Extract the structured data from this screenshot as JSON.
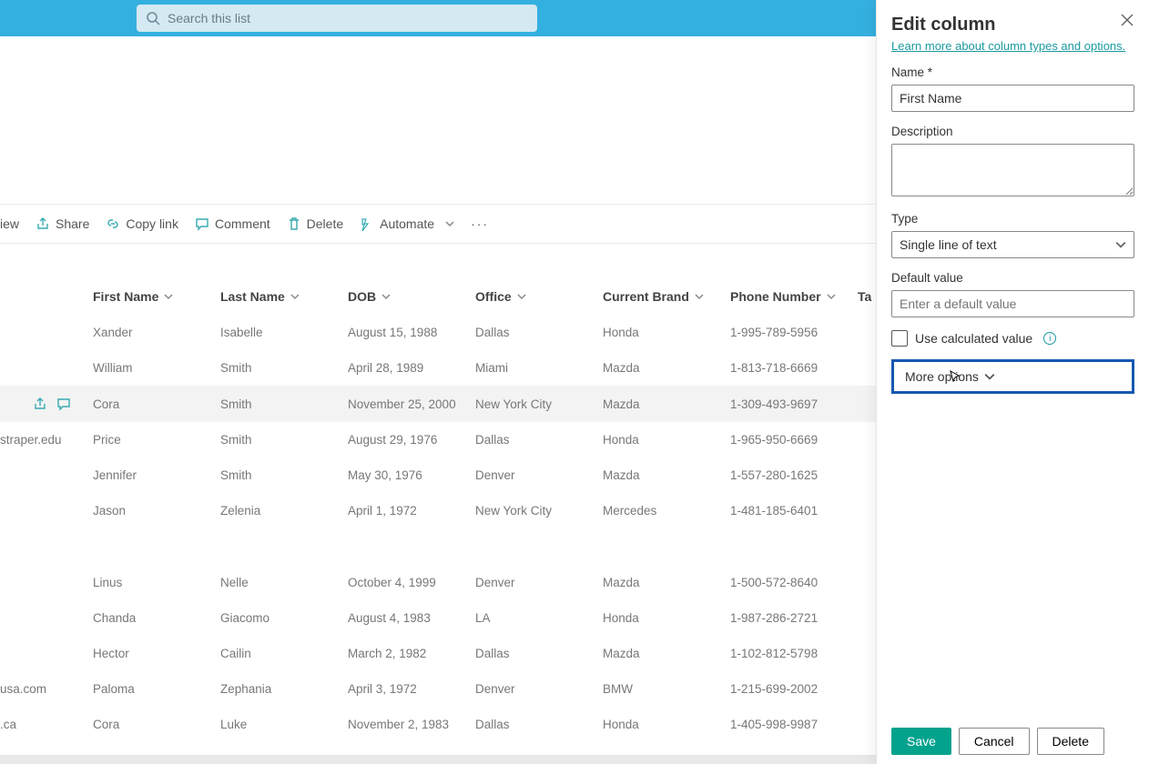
{
  "search": {
    "placeholder": "Search this list"
  },
  "commands": {
    "view": "iew",
    "share": "Share",
    "copylink": "Copy link",
    "comment": "Comment",
    "delete": "Delete",
    "automate": "Automate"
  },
  "columns": {
    "first_name": "First Name",
    "last_name": "Last Name",
    "dob": "DOB",
    "office": "Office",
    "current_brand": "Current Brand",
    "phone_number": "Phone Number",
    "ta": "Ta"
  },
  "rows": [
    {
      "pre": "",
      "first": "Xander",
      "last": "Isabelle",
      "dob": "August 15, 1988",
      "office": "Dallas",
      "brand": "Honda",
      "phone": "1-995-789-5956"
    },
    {
      "pre": "",
      "first": "William",
      "last": "Smith",
      "dob": "April 28, 1989",
      "office": "Miami",
      "brand": "Mazda",
      "phone": "1-813-718-6669"
    },
    {
      "pre": "",
      "first": "Cora",
      "last": "Smith",
      "dob": "November 25, 2000",
      "office": "New York City",
      "brand": "Mazda",
      "phone": "1-309-493-9697",
      "selected": true
    },
    {
      "pre": "straper.edu",
      "first": "Price",
      "last": "Smith",
      "dob": "August 29, 1976",
      "office": "Dallas",
      "brand": "Honda",
      "phone": "1-965-950-6669"
    },
    {
      "pre": "",
      "first": "Jennifer",
      "last": "Smith",
      "dob": "May 30, 1976",
      "office": "Denver",
      "brand": "Mazda",
      "phone": "1-557-280-1625"
    },
    {
      "pre": "",
      "first": "Jason",
      "last": "Zelenia",
      "dob": "April 1, 1972",
      "office": "New York City",
      "brand": "Mercedes",
      "phone": "1-481-185-6401"
    }
  ],
  "rows2": [
    {
      "pre": "",
      "first": "Linus",
      "last": "Nelle",
      "dob": "October 4, 1999",
      "office": "Denver",
      "brand": "Mazda",
      "phone": "1-500-572-8640"
    },
    {
      "pre": "",
      "first": "Chanda",
      "last": "Giacomo",
      "dob": "August 4, 1983",
      "office": "LA",
      "brand": "Honda",
      "phone": "1-987-286-2721"
    },
    {
      "pre": "",
      "first": "Hector",
      "last": "Cailin",
      "dob": "March 2, 1982",
      "office": "Dallas",
      "brand": "Mazda",
      "phone": "1-102-812-5798"
    },
    {
      "pre": "usa.com",
      "first": "Paloma",
      "last": "Zephania",
      "dob": "April 3, 1972",
      "office": "Denver",
      "brand": "BMW",
      "phone": "1-215-699-2002"
    },
    {
      "pre": ".ca",
      "first": "Cora",
      "last": "Luke",
      "dob": "November 2, 1983",
      "office": "Dallas",
      "brand": "Honda",
      "phone": "1-405-998-9987"
    }
  ],
  "panel": {
    "title": "Edit column",
    "learn": "Learn more about column types and options.",
    "name_label": "Name *",
    "name_value": "First Name",
    "desc_label": "Description",
    "type_label": "Type",
    "type_value": "Single line of text",
    "default_label": "Default value",
    "default_placeholder": "Enter a default value",
    "calc_label": "Use calculated value",
    "more_options": "More options",
    "save": "Save",
    "cancel": "Cancel",
    "delete": "Delete"
  }
}
